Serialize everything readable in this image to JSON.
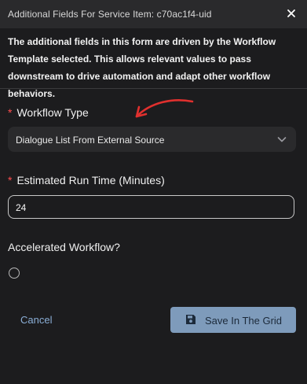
{
  "header": {
    "title": "Additional Fields For Service Item: c70ac1f4-uid",
    "close_icon": "close-icon"
  },
  "description": "The additional fields in this form are driven by the Workflow Template selected. This allows relevant values to pass downstream to drive automation and adapt other workflow behaviors.",
  "fields": {
    "workflow_type": {
      "required_mark": "*",
      "label": "Workflow Type",
      "value": "Dialogue List From External Source",
      "icon": "chevron-down-icon"
    },
    "estimated_run_time": {
      "required_mark": "*",
      "label": "Estimated Run Time (Minutes)",
      "value": "24"
    },
    "accelerated_workflow": {
      "label": "Accelerated Workflow?",
      "checked": false
    }
  },
  "actions": {
    "cancel_label": "Cancel",
    "save_label": "Save In The Grid",
    "save_icon": "floppy-disk-icon"
  },
  "annotation": {
    "arrow_color": "#e0302e"
  },
  "colors": {
    "background": "#1c1c1e",
    "header": "#2a2a2c",
    "required": "#ff4d4f",
    "link": "#8aaed6",
    "save_button": "#7e9bbb"
  }
}
